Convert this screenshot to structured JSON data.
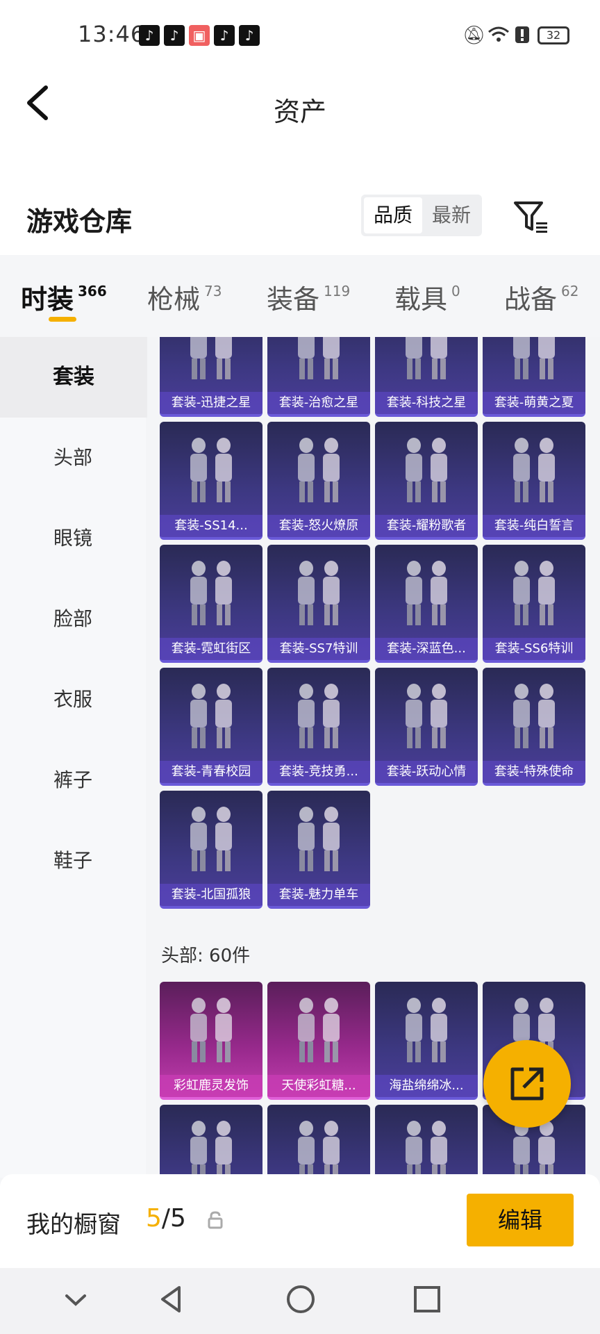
{
  "status_bar": {
    "time": "13:46",
    "battery": "32",
    "app_icons": [
      "tiktok-icon",
      "tiktok-icon",
      "gift-icon",
      "tiktok-icon",
      "tiktok-icon"
    ],
    "indicators": [
      "mute-icon",
      "wifi-icon",
      "alert-icon"
    ]
  },
  "header": {
    "title": "资产"
  },
  "warehouse": {
    "title": "游戏仓库",
    "sort_quality": "品质",
    "sort_newest": "最新"
  },
  "tabs": [
    {
      "label": "时装",
      "count": "366"
    },
    {
      "label": "枪械",
      "count": "73"
    },
    {
      "label": "装备",
      "count": "119"
    },
    {
      "label": "载具",
      "count": "0"
    },
    {
      "label": "战备",
      "count": "62"
    }
  ],
  "sidebar": [
    "套装",
    "头部",
    "眼镜",
    "脸部",
    "衣服",
    "裤子",
    "鞋子"
  ],
  "suits": [
    "套装-迅捷之星",
    "套装-治愈之星",
    "套装-科技之星",
    "套装-萌黄之夏",
    "套装-SS14...",
    "套装-怒火燎原",
    "套装-耀粉歌者",
    "套装-纯白誓言",
    "套装-霓虹街区",
    "套装-SS7特训",
    "套装-深蓝色...",
    "套装-SS6特训",
    "套装-青春校园",
    "套装-竞技勇...",
    "套装-跃动心情",
    "套装-特殊使命",
    "套装-北国孤狼",
    "套装-魅力单车"
  ],
  "head_section": {
    "title": "头部: 60件"
  },
  "head_items": [
    "彩虹鹿灵发饰",
    "天使彩虹糖...",
    "海盐绵绵冰...",
    "",
    "",
    "",
    "",
    ""
  ],
  "footer": {
    "showcase_label": "我的橱窗",
    "showcase_used": "5",
    "showcase_sep": "/",
    "showcase_total": "5",
    "edit_label": "编辑"
  },
  "colors": {
    "accent": "#f5b000",
    "card_purple": "#3d3882",
    "card_pink": "#c23eae"
  }
}
